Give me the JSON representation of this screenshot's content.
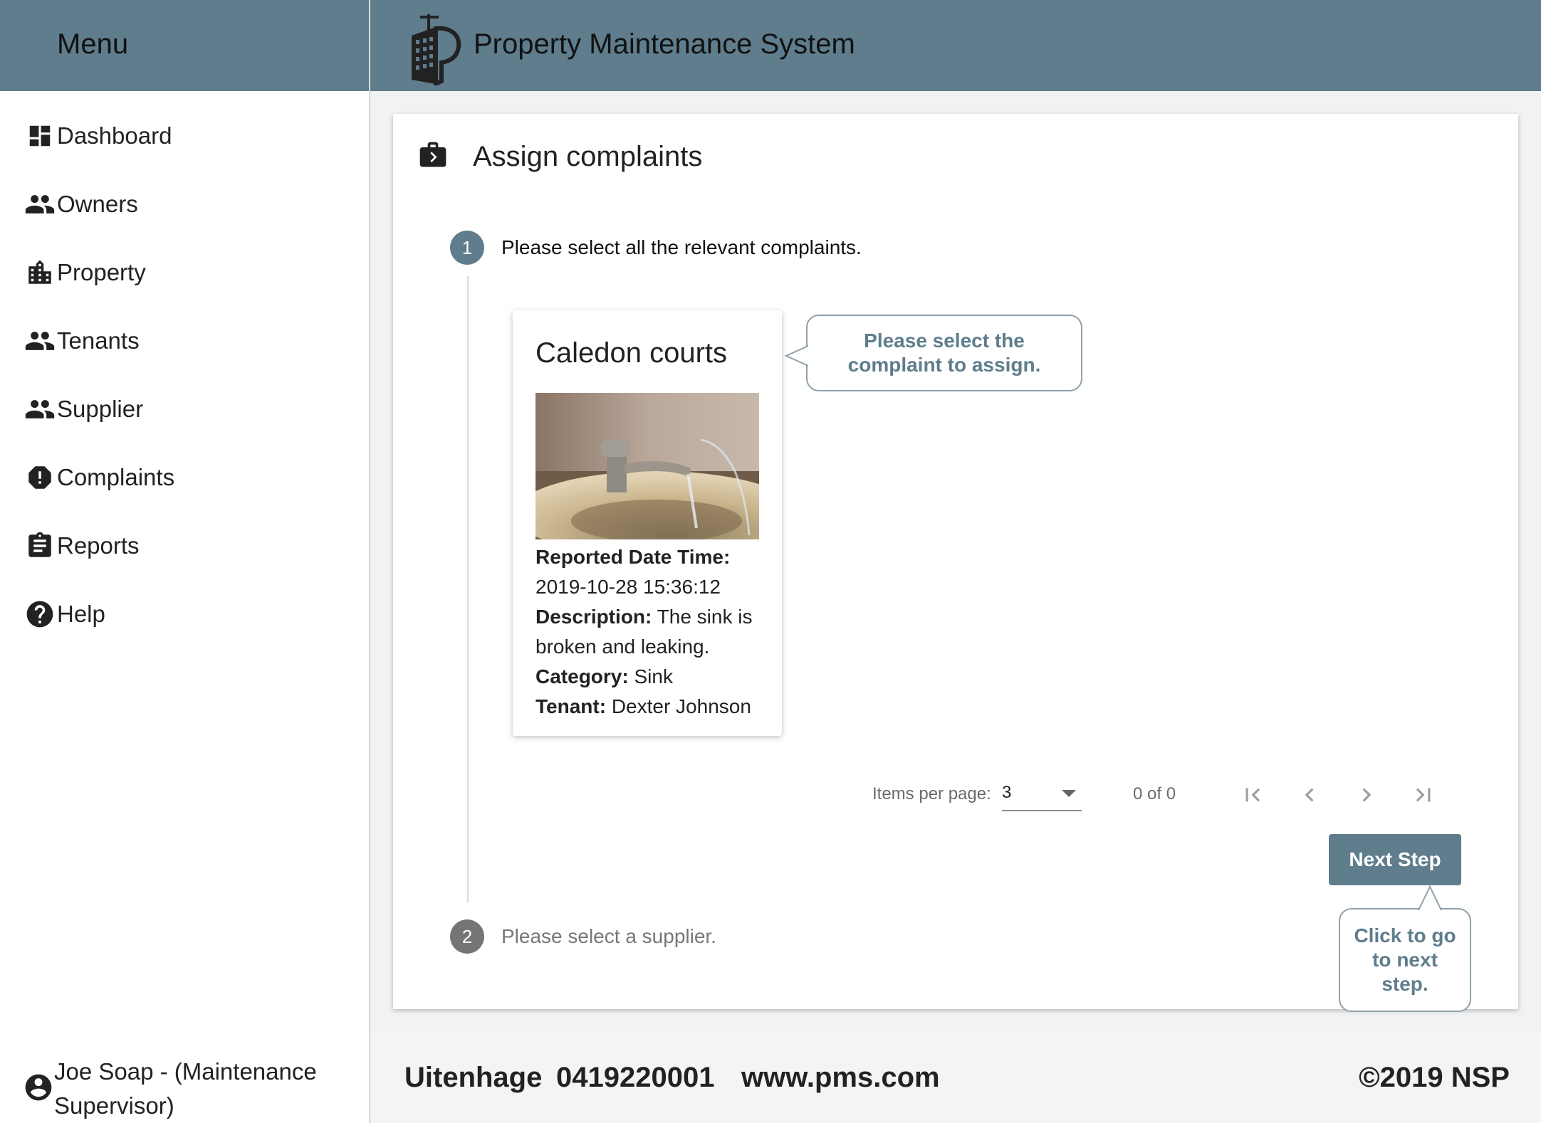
{
  "sidebar": {
    "menu_title": "Menu",
    "items": [
      {
        "label": "Dashboard",
        "icon": "dashboard-icon"
      },
      {
        "label": "Owners",
        "icon": "people-icon"
      },
      {
        "label": "Property",
        "icon": "building-icon"
      },
      {
        "label": "Tenants",
        "icon": "people-icon"
      },
      {
        "label": "Supplier",
        "icon": "people-icon"
      },
      {
        "label": "Complaints",
        "icon": "alert-icon"
      },
      {
        "label": "Reports",
        "icon": "clipboard-icon"
      },
      {
        "label": "Help",
        "icon": "help-icon"
      }
    ],
    "user_label": "Joe Soap - (Maintenance Supervisor)"
  },
  "header": {
    "app_title": "Property Maintenance System"
  },
  "main": {
    "title": "Assign complaints",
    "steps": [
      {
        "number": "1",
        "label": "Please select all the relevant complaints.",
        "active": true
      },
      {
        "number": "2",
        "label": "Please select a supplier.",
        "active": false
      }
    ],
    "complaint": {
      "property": "Caledon courts",
      "reported_label": "Reported Date Time:",
      "reported_value": "2019-10-28 15:36:12",
      "description_label": "Description:",
      "description_value": "The sink is broken and leaking.",
      "category_label": "Category:",
      "category_value": "Sink",
      "tenant_label": "Tenant:",
      "tenant_value": "Dexter Johnson"
    },
    "complaint_tooltip": "Please select the complaint to assign.",
    "paginator": {
      "items_per_page_label": "Items per page:",
      "items_per_page_value": "3",
      "range": "0 of 0"
    },
    "next_button": "Next Step",
    "next_tooltip": "Click to go to next step."
  },
  "footer": {
    "city": "Uitenhage",
    "phone": "0419220001",
    "website": "www.pms.com",
    "copyright": "©2019 NSP"
  },
  "colors": {
    "primary": "#5f7d8c",
    "step_inactive": "#757575"
  }
}
